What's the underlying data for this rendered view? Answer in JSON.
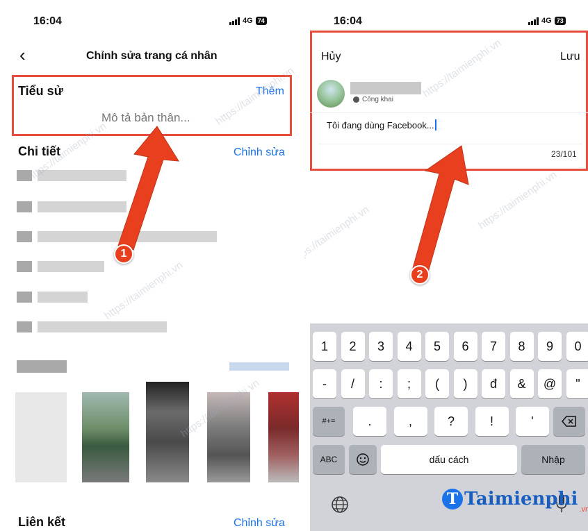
{
  "left": {
    "time": "16:04",
    "network": "4G",
    "battery": "74",
    "header_title": "Chỉnh sửa trang cá nhân",
    "bio_title": "Tiểu sử",
    "bio_action": "Thêm",
    "bio_placeholder": "Mô tả bản thân...",
    "details_title": "Chi tiết",
    "details_action": "Chỉnh sửa",
    "links_title": "Liên kết",
    "links_action": "Chỉnh sửa",
    "badge": "1"
  },
  "right": {
    "time": "16:04",
    "network": "4G",
    "battery": "73",
    "cancel": "Hủy",
    "save": "Lưu",
    "privacy": "Công khai",
    "bio_text": "Tôi đang dùng Facebook...",
    "char_count": "23/101",
    "badge": "2",
    "keyboard": {
      "row1": [
        "1",
        "2",
        "3",
        "4",
        "5",
        "6",
        "7",
        "8",
        "9",
        "0"
      ],
      "row2": [
        "-",
        "/",
        ":",
        ";",
        "(",
        ")",
        "đ",
        "&",
        "@",
        "\""
      ],
      "row3_left": "#+=",
      "row3": [
        ".",
        ",",
        "?",
        "!",
        "'"
      ],
      "abc": "ABC",
      "space": "dấu cách",
      "return": "Nhập"
    }
  },
  "watermark": {
    "text": "https://taimienphi.vn",
    "logo": "Taimienphi",
    "logo_suffix": ".vn"
  },
  "colors": {
    "accent": "#1a73e8",
    "highlight": "#e74c3c",
    "arrow": "#e8401f"
  }
}
